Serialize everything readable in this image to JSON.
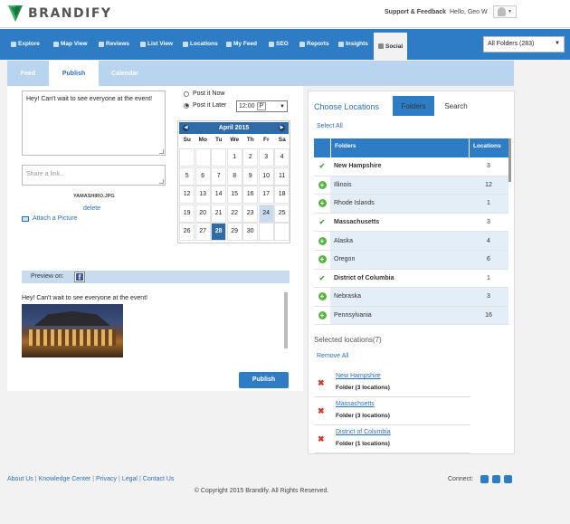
{
  "brand": {
    "logo_text": "BRANDIFY"
  },
  "header": {
    "support_label": "Support & Feedback",
    "greeting": "Hello, Geo W"
  },
  "nav": {
    "items": [
      {
        "label": "Explore"
      },
      {
        "label": "Map View"
      },
      {
        "label": "Reviews"
      },
      {
        "label": "List View"
      },
      {
        "label": "Locations"
      },
      {
        "label": "My Feed"
      },
      {
        "label": "SEO"
      },
      {
        "label": "Reports"
      },
      {
        "label": "Insights"
      },
      {
        "label": "Social"
      }
    ],
    "active": "Social",
    "folder_select": "All Folders (283)"
  },
  "subtabs": [
    {
      "label": "Feed"
    },
    {
      "label": "Publish"
    },
    {
      "label": "Calendar"
    }
  ],
  "compose": {
    "message": "Hey! Can't wait to see everyone at the event!",
    "link_placeholder": "Share a link...",
    "filename": "YAMASHIRO.JPG",
    "delete_label": "delete",
    "attach_label": "Attach a Picture",
    "post_now_label": "Post it Now",
    "post_later_label": "Post it Later",
    "time_value": "12:00",
    "ampm": "P",
    "selected_option": "post_later"
  },
  "calendar": {
    "month": "April 2015",
    "weekdays": [
      "Su",
      "Mo",
      "Tu",
      "We",
      "Th",
      "Fr",
      "Sa"
    ],
    "days": [
      "",
      "",
      "",
      "1",
      "2",
      "3",
      "4",
      "5",
      "6",
      "7",
      "8",
      "9",
      "10",
      "11",
      "12",
      "13",
      "14",
      "15",
      "16",
      "17",
      "18",
      "19",
      "20",
      "21",
      "22",
      "23",
      "24",
      "25",
      "26",
      "27",
      "28",
      "29",
      "30",
      "",
      ""
    ],
    "today": "24",
    "selected": "28"
  },
  "preview": {
    "label": "Preview on:",
    "network": "facebook",
    "text": "Hey! Can't wait to see everyone at the event!"
  },
  "publish_label": "Publish",
  "locations": {
    "title": "Choose Locations",
    "tabs": [
      {
        "label": "Folders"
      },
      {
        "label": "Search"
      }
    ],
    "select_all": "Select All",
    "col_folders": "Folders",
    "col_locations": "Locations",
    "rows": [
      {
        "name": "New Hampshire",
        "count": "3",
        "selected": true
      },
      {
        "name": "Illinois",
        "count": "12",
        "selected": false
      },
      {
        "name": "Rhode Islands",
        "count": "1",
        "selected": false
      },
      {
        "name": "Massachusetts",
        "count": "3",
        "selected": true
      },
      {
        "name": "Alaska",
        "count": "4",
        "selected": false
      },
      {
        "name": "Oregon",
        "count": "6",
        "selected": false
      },
      {
        "name": "District of Columbia",
        "count": "1",
        "selected": true
      },
      {
        "name": "Nebraska",
        "count": "3",
        "selected": false
      },
      {
        "name": "Pennsylvania",
        "count": "16",
        "selected": false
      }
    ],
    "selected_title": "Selected locations(7)",
    "remove_all": "Remove All",
    "selected_items": [
      {
        "name": "New Hampshire",
        "sub": "Folder (3 locations)"
      },
      {
        "name": "Massachsetts",
        "sub": "Folder (3 locations)"
      },
      {
        "name": "District of Columbia",
        "sub": "Folder (1 locations)"
      }
    ]
  },
  "footer": {
    "links": [
      "About Us",
      "Knowledge Center",
      "Privacy",
      "Legal",
      "Contact Us"
    ],
    "connect_label": "Connect:",
    "copyright": "© Copyright 2015 Brandify. All Rights Reserved."
  },
  "colors": {
    "primary": "#2e7dc4",
    "accent": "#2d6fb7",
    "check": "#4aa346",
    "remove": "#d9362b"
  }
}
